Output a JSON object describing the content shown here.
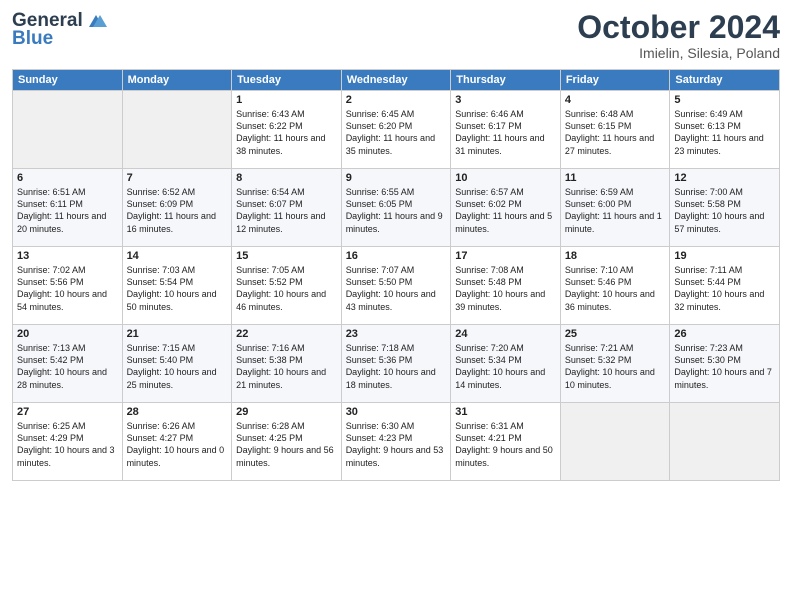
{
  "header": {
    "logo_line1": "General",
    "logo_line2": "Blue",
    "month": "October 2024",
    "location": "Imielin, Silesia, Poland"
  },
  "days_of_week": [
    "Sunday",
    "Monday",
    "Tuesday",
    "Wednesday",
    "Thursday",
    "Friday",
    "Saturday"
  ],
  "weeks": [
    [
      {
        "day": "",
        "empty": true
      },
      {
        "day": "",
        "empty": true
      },
      {
        "day": "1",
        "sunrise": "Sunrise: 6:43 AM",
        "sunset": "Sunset: 6:22 PM",
        "daylight": "Daylight: 11 hours and 38 minutes."
      },
      {
        "day": "2",
        "sunrise": "Sunrise: 6:45 AM",
        "sunset": "Sunset: 6:20 PM",
        "daylight": "Daylight: 11 hours and 35 minutes."
      },
      {
        "day": "3",
        "sunrise": "Sunrise: 6:46 AM",
        "sunset": "Sunset: 6:17 PM",
        "daylight": "Daylight: 11 hours and 31 minutes."
      },
      {
        "day": "4",
        "sunrise": "Sunrise: 6:48 AM",
        "sunset": "Sunset: 6:15 PM",
        "daylight": "Daylight: 11 hours and 27 minutes."
      },
      {
        "day": "5",
        "sunrise": "Sunrise: 6:49 AM",
        "sunset": "Sunset: 6:13 PM",
        "daylight": "Daylight: 11 hours and 23 minutes."
      }
    ],
    [
      {
        "day": "6",
        "sunrise": "Sunrise: 6:51 AM",
        "sunset": "Sunset: 6:11 PM",
        "daylight": "Daylight: 11 hours and 20 minutes."
      },
      {
        "day": "7",
        "sunrise": "Sunrise: 6:52 AM",
        "sunset": "Sunset: 6:09 PM",
        "daylight": "Daylight: 11 hours and 16 minutes."
      },
      {
        "day": "8",
        "sunrise": "Sunrise: 6:54 AM",
        "sunset": "Sunset: 6:07 PM",
        "daylight": "Daylight: 11 hours and 12 minutes."
      },
      {
        "day": "9",
        "sunrise": "Sunrise: 6:55 AM",
        "sunset": "Sunset: 6:05 PM",
        "daylight": "Daylight: 11 hours and 9 minutes."
      },
      {
        "day": "10",
        "sunrise": "Sunrise: 6:57 AM",
        "sunset": "Sunset: 6:02 PM",
        "daylight": "Daylight: 11 hours and 5 minutes."
      },
      {
        "day": "11",
        "sunrise": "Sunrise: 6:59 AM",
        "sunset": "Sunset: 6:00 PM",
        "daylight": "Daylight: 11 hours and 1 minute."
      },
      {
        "day": "12",
        "sunrise": "Sunrise: 7:00 AM",
        "sunset": "Sunset: 5:58 PM",
        "daylight": "Daylight: 10 hours and 57 minutes."
      }
    ],
    [
      {
        "day": "13",
        "sunrise": "Sunrise: 7:02 AM",
        "sunset": "Sunset: 5:56 PM",
        "daylight": "Daylight: 10 hours and 54 minutes."
      },
      {
        "day": "14",
        "sunrise": "Sunrise: 7:03 AM",
        "sunset": "Sunset: 5:54 PM",
        "daylight": "Daylight: 10 hours and 50 minutes."
      },
      {
        "day": "15",
        "sunrise": "Sunrise: 7:05 AM",
        "sunset": "Sunset: 5:52 PM",
        "daylight": "Daylight: 10 hours and 46 minutes."
      },
      {
        "day": "16",
        "sunrise": "Sunrise: 7:07 AM",
        "sunset": "Sunset: 5:50 PM",
        "daylight": "Daylight: 10 hours and 43 minutes."
      },
      {
        "day": "17",
        "sunrise": "Sunrise: 7:08 AM",
        "sunset": "Sunset: 5:48 PM",
        "daylight": "Daylight: 10 hours and 39 minutes."
      },
      {
        "day": "18",
        "sunrise": "Sunrise: 7:10 AM",
        "sunset": "Sunset: 5:46 PM",
        "daylight": "Daylight: 10 hours and 36 minutes."
      },
      {
        "day": "19",
        "sunrise": "Sunrise: 7:11 AM",
        "sunset": "Sunset: 5:44 PM",
        "daylight": "Daylight: 10 hours and 32 minutes."
      }
    ],
    [
      {
        "day": "20",
        "sunrise": "Sunrise: 7:13 AM",
        "sunset": "Sunset: 5:42 PM",
        "daylight": "Daylight: 10 hours and 28 minutes."
      },
      {
        "day": "21",
        "sunrise": "Sunrise: 7:15 AM",
        "sunset": "Sunset: 5:40 PM",
        "daylight": "Daylight: 10 hours and 25 minutes."
      },
      {
        "day": "22",
        "sunrise": "Sunrise: 7:16 AM",
        "sunset": "Sunset: 5:38 PM",
        "daylight": "Daylight: 10 hours and 21 minutes."
      },
      {
        "day": "23",
        "sunrise": "Sunrise: 7:18 AM",
        "sunset": "Sunset: 5:36 PM",
        "daylight": "Daylight: 10 hours and 18 minutes."
      },
      {
        "day": "24",
        "sunrise": "Sunrise: 7:20 AM",
        "sunset": "Sunset: 5:34 PM",
        "daylight": "Daylight: 10 hours and 14 minutes."
      },
      {
        "day": "25",
        "sunrise": "Sunrise: 7:21 AM",
        "sunset": "Sunset: 5:32 PM",
        "daylight": "Daylight: 10 hours and 10 minutes."
      },
      {
        "day": "26",
        "sunrise": "Sunrise: 7:23 AM",
        "sunset": "Sunset: 5:30 PM",
        "daylight": "Daylight: 10 hours and 7 minutes."
      }
    ],
    [
      {
        "day": "27",
        "sunrise": "Sunrise: 6:25 AM",
        "sunset": "Sunset: 4:29 PM",
        "daylight": "Daylight: 10 hours and 3 minutes."
      },
      {
        "day": "28",
        "sunrise": "Sunrise: 6:26 AM",
        "sunset": "Sunset: 4:27 PM",
        "daylight": "Daylight: 10 hours and 0 minutes."
      },
      {
        "day": "29",
        "sunrise": "Sunrise: 6:28 AM",
        "sunset": "Sunset: 4:25 PM",
        "daylight": "Daylight: 9 hours and 56 minutes."
      },
      {
        "day": "30",
        "sunrise": "Sunrise: 6:30 AM",
        "sunset": "Sunset: 4:23 PM",
        "daylight": "Daylight: 9 hours and 53 minutes."
      },
      {
        "day": "31",
        "sunrise": "Sunrise: 6:31 AM",
        "sunset": "Sunset: 4:21 PM",
        "daylight": "Daylight: 9 hours and 50 minutes."
      },
      {
        "day": "",
        "empty": true
      },
      {
        "day": "",
        "empty": true
      }
    ]
  ]
}
